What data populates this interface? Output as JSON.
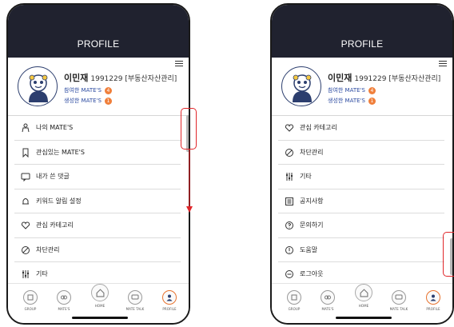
{
  "header": {
    "title": "PROFILE"
  },
  "profile": {
    "name": "이민재",
    "info": "1991229 [부동산자산관리]",
    "joined_label": "참여한 MATE'S",
    "joined_count": "4",
    "created_label": "생성한 MATE'S",
    "created_count": "1"
  },
  "left_menu": [
    {
      "label": "나의 MATE'S",
      "icon": "person-icon"
    },
    {
      "label": "관심있는 MATE'S",
      "icon": "bookmark-icon"
    },
    {
      "label": "내가 쓴 댓글",
      "icon": "comment-icon"
    },
    {
      "label": "키워드 알림 설정",
      "icon": "bell-icon"
    },
    {
      "label": "관심 카테고리",
      "icon": "heart-icon"
    },
    {
      "label": "차단관리",
      "icon": "block-icon"
    },
    {
      "label": "기타",
      "icon": "sliders-icon"
    }
  ],
  "right_menu": [
    {
      "label": "관심 카테고리",
      "icon": "heart-icon"
    },
    {
      "label": "차단관리",
      "icon": "block-icon"
    },
    {
      "label": "기타",
      "icon": "sliders-icon"
    },
    {
      "label": "공지사항",
      "icon": "notice-icon"
    },
    {
      "label": "문의하기",
      "icon": "question-icon"
    },
    {
      "label": "도움말",
      "icon": "info-icon"
    },
    {
      "label": "로그아웃",
      "icon": "logout-icon"
    }
  ],
  "bottom_nav": [
    {
      "label": "GROUP",
      "icon": "group-icon"
    },
    {
      "label": "MATE'S",
      "icon": "mates-icon"
    },
    {
      "label": "HOME",
      "icon": "home-icon"
    },
    {
      "label": "MATE TALK",
      "icon": "talk-icon"
    },
    {
      "label": "PROFILE",
      "icon": "profile-icon"
    }
  ],
  "colors": {
    "header_bg": "#20222f",
    "accent": "#f07f3b",
    "highlight": "#e0262a",
    "link": "#2b4aa0"
  }
}
